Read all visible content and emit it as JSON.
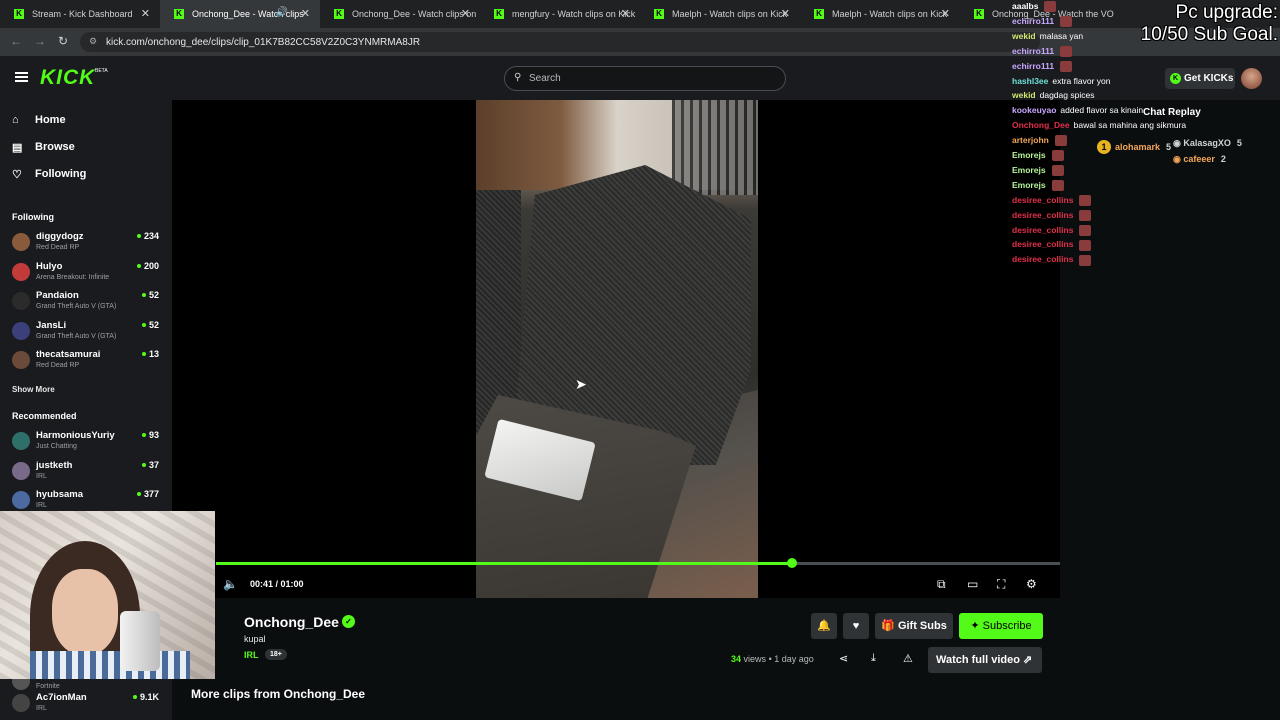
{
  "browser": {
    "tabs": [
      {
        "title": "Stream - Kick Dashboard",
        "active": false
      },
      {
        "title": "Onchong_Dee - Watch clips",
        "active": true
      },
      {
        "title": "Onchong_Dee - Watch clips on",
        "active": false
      },
      {
        "title": "mengfury - Watch clips on Kick",
        "active": false
      },
      {
        "title": "Maelph - Watch clips on Kick",
        "active": false
      },
      {
        "title": "Maelph - Watch clips on Kick",
        "active": false
      },
      {
        "title": "Onchong_Dee - Watch the VO",
        "active": false
      }
    ],
    "url": "kick.com/onchong_dee/clips/clip_01K7B82CC58V2Z0C3YNMRMA8JR"
  },
  "header": {
    "logo": "KICK",
    "logo_badge": "BETA",
    "search_placeholder": "Search",
    "get_kicks_label": "Get KICKs"
  },
  "sidebar": {
    "nav": [
      {
        "label": "Home",
        "icon": "home-icon"
      },
      {
        "label": "Browse",
        "icon": "browse-icon"
      },
      {
        "label": "Following",
        "icon": "heart-icon"
      }
    ],
    "following_title": "Following",
    "following": [
      {
        "name": "diggydogz",
        "game": "Red Dead RP",
        "viewers": "234",
        "color": "#8a5a3c"
      },
      {
        "name": "Hulyo",
        "game": "Arena Breakout: Infinite",
        "viewers": "200",
        "color": "#c23b3b"
      },
      {
        "name": "Pandaion",
        "game": "Grand Theft Auto V (GTA)",
        "viewers": "52",
        "color": "#2b2b2b"
      },
      {
        "name": "JansLi",
        "game": "Grand Theft Auto V (GTA)",
        "viewers": "52",
        "color": "#3b3f7a"
      },
      {
        "name": "thecatsamurai",
        "game": "Red Dead RP",
        "viewers": "13",
        "color": "#6b4a3a"
      }
    ],
    "show_more": "Show More",
    "recommended_title": "Recommended",
    "recommended": [
      {
        "name": "HarmoniousYuriy",
        "game": "Just Chatting",
        "viewers": "93",
        "color": "#2f6f6a"
      },
      {
        "name": "justketh",
        "game": "IRL",
        "viewers": "37",
        "color": "#7a6a8a"
      },
      {
        "name": "hyubsama",
        "game": "IRL",
        "viewers": "377",
        "color": "#4a6aa0"
      }
    ],
    "lower": [
      {
        "name": "",
        "game": "Fortnite",
        "viewers": "",
        "color": "#555"
      },
      {
        "name": "Ac7ionMan",
        "game": "IRL",
        "viewers": "9.1K",
        "color": "#444"
      }
    ]
  },
  "player": {
    "time": "00:41 / 01:00",
    "progress_fraction": 0.683
  },
  "clip_info": {
    "streamer": "Onchong_Dee",
    "title": "kupal",
    "category": "IRL",
    "badge": "18+",
    "views": "34",
    "views_label": "views",
    "age": "• 1 day ago",
    "gift_subs": "Gift Subs",
    "subscribe": "Subscribe",
    "watch_full": "Watch full video",
    "more_clips": "More clips from Onchong_Dee"
  },
  "overlay": {
    "goal_line1": "Pc upgrade:",
    "goal_line2": "10/50 Sub Goal.",
    "chat_replay": "Chat Replay",
    "chat": [
      {
        "user": "aaalbs",
        "text": "",
        "color": "#ffffff",
        "emote": true
      },
      {
        "user": "echirro111",
        "text": "",
        "color": "#c9a8ff",
        "emote": true
      },
      {
        "user": "wekid",
        "text": "malasa yan",
        "color": "#cfe870",
        "emote": false
      },
      {
        "user": "echirro111",
        "text": "",
        "color": "#c9a8ff",
        "emote": true
      },
      {
        "user": "echirro111",
        "text": "",
        "color": "#c9a8ff",
        "emote": true
      },
      {
        "user": "hashl3ee",
        "text": "extra flavor yon",
        "color": "#6fe0d8",
        "emote": false
      },
      {
        "user": "wekid",
        "text": "dagdag spices",
        "color": "#cfe870",
        "emote": false
      },
      {
        "user": "kookeuyao",
        "text": "added flavor sa kinain",
        "color": "#c9a8ff",
        "emote": false
      },
      {
        "user": "Onchong_Dee",
        "text": "bawal sa mahina ang sikmura",
        "color": "#e0304a",
        "emote": false
      },
      {
        "user": "arterjohn",
        "text": "",
        "color": "#f2a65a",
        "emote": true
      },
      {
        "user": "Emorejs",
        "text": "",
        "color": "#b7f59a",
        "emote": true
      },
      {
        "user": "Emorejs",
        "text": "",
        "color": "#b7f59a",
        "emote": true
      },
      {
        "user": "Emorejs",
        "text": "",
        "color": "#b7f59a",
        "emote": true
      },
      {
        "user": "desiree_collins",
        "text": "",
        "color": "#e0304a",
        "emote": true
      },
      {
        "user": "desiree_collins",
        "text": "",
        "color": "#e0304a",
        "emote": true
      },
      {
        "user": "desiree_collins",
        "text": "",
        "color": "#e0304a",
        "emote": true
      },
      {
        "user": "desiree_collins",
        "text": "",
        "color": "#e0304a",
        "emote": true
      },
      {
        "user": "desiree_collins",
        "text": "",
        "color": "#e0304a",
        "emote": true
      }
    ],
    "leaderboard": [
      {
        "rank": "1",
        "name": "alohamark",
        "score": "5"
      },
      {
        "rank": "",
        "name": "KalasagXO",
        "score": "5"
      },
      {
        "rank": "",
        "name": "cafeeer",
        "score": "2"
      }
    ]
  },
  "colors": {
    "accent": "#53fc18",
    "background": "#0b0e0f",
    "sidebar": "#191b1f"
  }
}
